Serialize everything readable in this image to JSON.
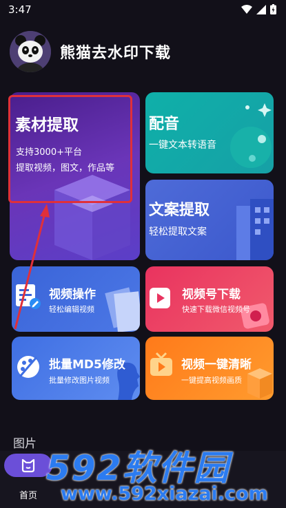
{
  "status_bar": {
    "time": "3:47"
  },
  "app": {
    "title": "熊猫去水印下载"
  },
  "cards": {
    "material": {
      "title": "素材提取",
      "line1": "支持3000+平台",
      "line2": "提取视频，图文，作品等"
    },
    "dub": {
      "title": "配音",
      "subtitle": "一键文本转语音"
    },
    "copy": {
      "title": "文案提取",
      "subtitle": "轻松提取文案"
    },
    "video_op": {
      "title": "视频操作",
      "subtitle": "轻松编辑视频"
    },
    "channel_dl": {
      "title": "视频号下载",
      "subtitle": "快速下载微信视频号"
    },
    "md5": {
      "title": "批量MD5修改",
      "subtitle": "批量修改图片视频"
    },
    "hd": {
      "title": "视频一键清晰",
      "subtitle": "一键提高视频画质"
    }
  },
  "section": {
    "label": "图片"
  },
  "tabbar": {
    "home_label": "首页"
  },
  "watermark": {
    "brand": "592软件园",
    "url": "www.592xiazai.com"
  },
  "colors": {
    "background": "#121019",
    "highlight": "#e0303a",
    "accent": "#6b4fd8"
  }
}
